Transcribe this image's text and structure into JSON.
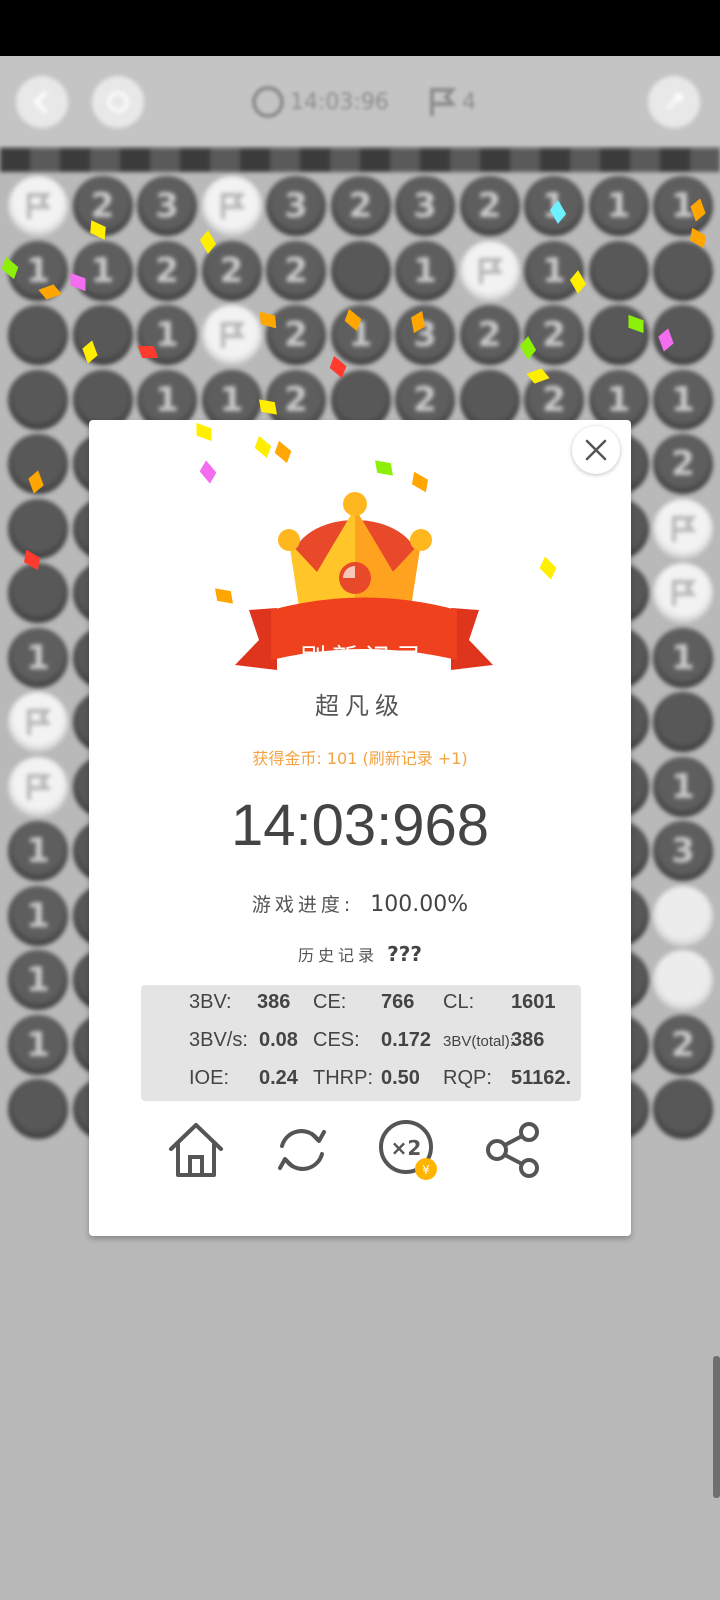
{
  "game": {
    "timer": "14:03:96",
    "flags": "4",
    "board": [
      [
        "F",
        "2",
        "3",
        "F",
        "3",
        "2",
        "3",
        "2",
        "1",
        "1",
        "1"
      ],
      [
        "1",
        "1",
        "2",
        "2",
        "2",
        "",
        "1",
        "F",
        "1",
        "",
        ""
      ],
      [
        "",
        "",
        "1",
        "F",
        "2",
        "1",
        "3",
        "2",
        "2",
        "",
        ""
      ],
      [
        "",
        "",
        "1",
        "1",
        "2",
        "",
        "2",
        "",
        "2",
        "1",
        "1"
      ],
      [
        "",
        "",
        "",
        "",
        "",
        "",
        "",
        "",
        "",
        "",
        "2"
      ],
      [
        "",
        "",
        "",
        "",
        "",
        "",
        "",
        "",
        "",
        "",
        "F"
      ],
      [
        "",
        "",
        "",
        "",
        "",
        "",
        "",
        "",
        "",
        "",
        "F"
      ],
      [
        "1",
        "",
        "",
        "",
        "",
        "",
        "",
        "",
        "",
        "",
        "1"
      ],
      [
        "F",
        "",
        "",
        "",
        "",
        "",
        "",
        "",
        "",
        "",
        ""
      ],
      [
        "F",
        "",
        "",
        "",
        "",
        "",
        "",
        "",
        "",
        "",
        "1"
      ],
      [
        "1",
        "",
        "",
        "",
        "",
        "",
        "",
        "",
        "",
        "",
        "3"
      ],
      [
        "1",
        "",
        "",
        "",
        "",
        "",
        "",
        "",
        "",
        "",
        "O"
      ],
      [
        "1",
        "",
        "",
        "",
        "",
        "",
        "",
        "",
        "",
        "",
        "O"
      ],
      [
        "1",
        "",
        "",
        "",
        "",
        "",
        "",
        "",
        "",
        "",
        "2"
      ],
      [
        "",
        "",
        "",
        "",
        "",
        "",
        "",
        "",
        "",
        "",
        ""
      ]
    ]
  },
  "result": {
    "ribbon": "刷新记录",
    "level": "超凡级",
    "coins_label": "获得金币:",
    "coins_value": " 101 (",
    "coins_record": "刷新记录",
    "coins_bonus": " +1)",
    "time": "14:03:968",
    "progress_label": "游戏进度:",
    "progress_value": "100.00%",
    "history_label": "历史记录",
    "history_value": "???"
  },
  "stats": {
    "row1": {
      "k1": "3BV:",
      "v1": "386",
      "k2": "CE:",
      "v2": "766",
      "k3": "CL:",
      "v3": "1601"
    },
    "row2": {
      "k1": "3BV/s:",
      "v1": "0.08",
      "k2": "CES:",
      "v2": "0.172",
      "k3": "3BV(total):",
      "v3": "386"
    },
    "row3": {
      "k1": "IOE:",
      "v1": "0.24",
      "k2": "THRP:",
      "v2": "0.50",
      "k3": "RQP:",
      "v3": "51162."
    }
  },
  "actions": {
    "home": "home-icon",
    "replay": "refresh-icon",
    "double": "×2",
    "share": "share-icon"
  },
  "colors": {
    "ribbon": "#e8391c",
    "crown": "#ffc529",
    "coins": "#f4a340"
  }
}
